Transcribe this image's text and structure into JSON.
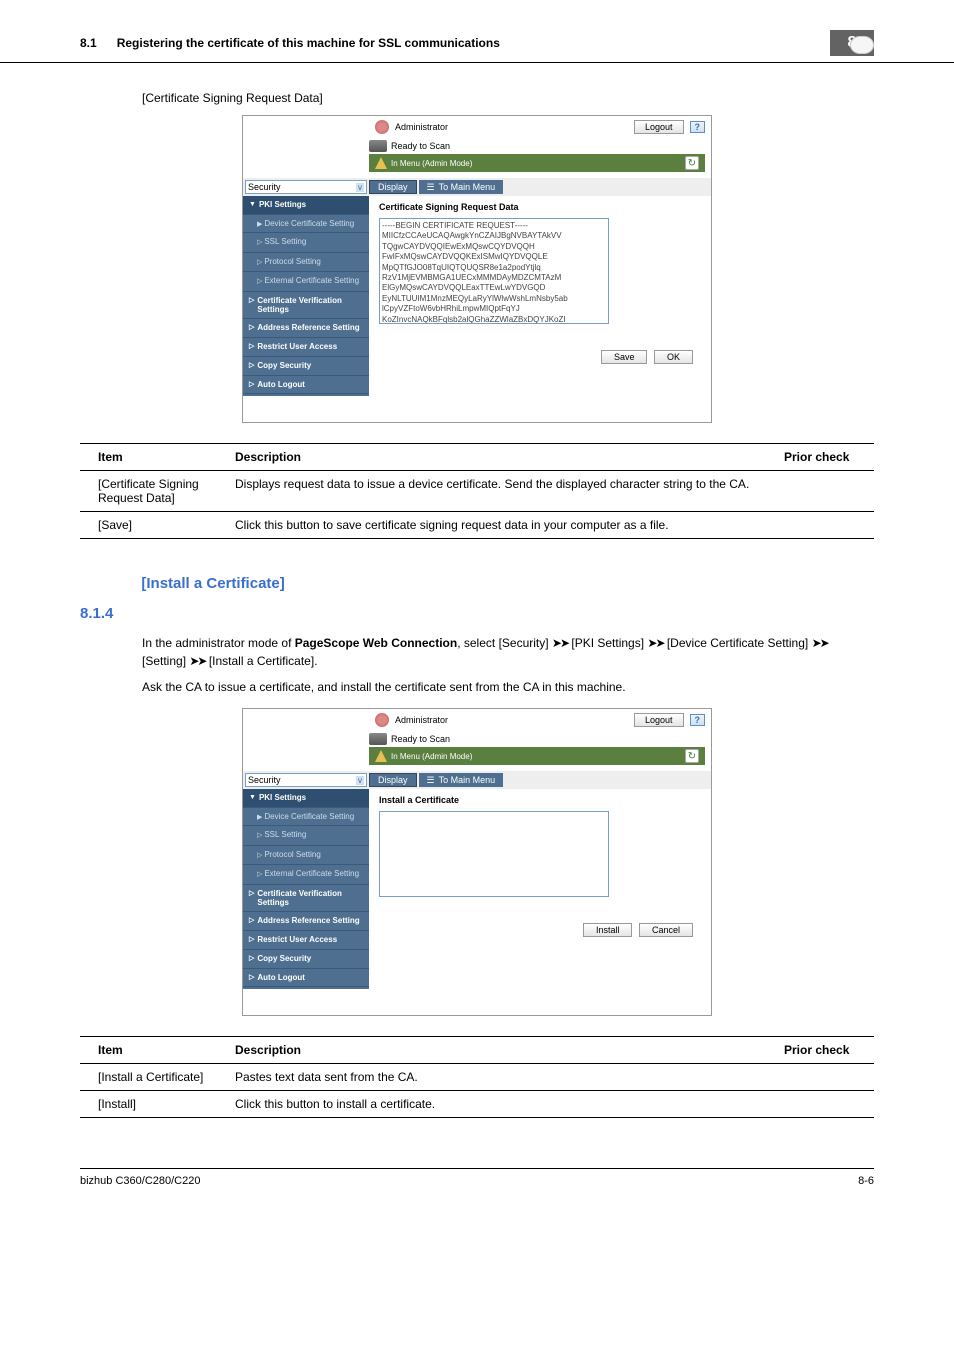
{
  "header": {
    "section_num": "8.1",
    "title": "Registering the certificate of this machine for SSL communications",
    "chapter_badge": "8"
  },
  "caption1": "[Certificate Signing Request Data]",
  "screenshot1": {
    "admin_label": "Administrator",
    "logout": "Logout",
    "help": "?",
    "ready": "Ready to Scan",
    "menu_status": "In Menu (Admin Mode)",
    "select_value": "Security",
    "display_btn": "Display",
    "to_main_menu": "To Main Menu",
    "sidebar": {
      "pki": "PKI Settings",
      "device_cert": "Device Certificate Setting",
      "ssl": "SSL Setting",
      "protocol": "Protocol Setting",
      "external_cert": "External Certificate Setting",
      "cert_verify": "Certificate Verification Settings",
      "addr_ref": "Address Reference Setting",
      "restrict": "Restrict User Access",
      "copy_sec": "Copy Security",
      "auto_logout": "Auto Logout"
    },
    "main_title": "Certificate Signing Request Data",
    "textarea_content": "-----BEGIN CERTIFICATE REQUEST-----\nMIICfzCCAeUCAQAwgkYnCZAIJBgNVBAYTAkVV\nTQgwCAYDVQQIEwExMQswCQYDVQQH\nFwIFxMQswCAYDVQQKExISMwIQYDVQQLE\nMpQTfGJO08TqUIQTQUQSR8e1a2podYtjlq\nRzV1MjEVMBMGA1UECxMMMDAyMDZCMTAzM\nElGyMQswCAYDVQQLEaxTTEwLwYDVGQD\nEyNLTUUIM1MnzMEQyLaRyYlWlwWshLmNsby5ab\nlCpyVZFtoW6vbHRhiLmpwMIQptFqYJ\nKoZInvcNAQkBFqlsb2alQGhaZZWlaZBxDQYJKoZI",
    "save_btn": "Save",
    "ok_btn": "OK"
  },
  "table1": {
    "headers": {
      "item": "Item",
      "desc": "Description",
      "prior": "Prior check"
    },
    "row1_item": "[Certificate Signing Request Data]",
    "row1_desc": "Displays request data to issue a device certificate. Send the displayed character string to the CA.",
    "row2_item": "[Save]",
    "row2_desc": "Click this button to save certificate signing request data in your computer as a file."
  },
  "section2": {
    "num": "8.1.4",
    "title": "[Install a Certificate]",
    "para1_a": "In the administrator mode of ",
    "para1_b": "PageScope Web Connection",
    "para1_c": ", select [Security] ",
    "para1_d": " [PKI Settings] ",
    "para1_e": " [Device Certificate Setting] ",
    "para1_f": " [Setting] ",
    "para1_g": " [Install a Certificate].",
    "para2": "Ask the CA to issue a certificate, and install the certificate sent from the CA in this machine."
  },
  "screenshot2": {
    "main_title": "Install a Certificate",
    "install_btn": "Install",
    "cancel_btn": "Cancel"
  },
  "table2": {
    "headers": {
      "item": "Item",
      "desc": "Description",
      "prior": "Prior check"
    },
    "row1_item": "[Install a Certificate]",
    "row1_desc": "Pastes text data sent from the CA.",
    "row2_item": "[Install]",
    "row2_desc": "Click this button to install a certificate."
  },
  "footer": {
    "model": "bizhub C360/C280/C220",
    "page": "8-6"
  }
}
